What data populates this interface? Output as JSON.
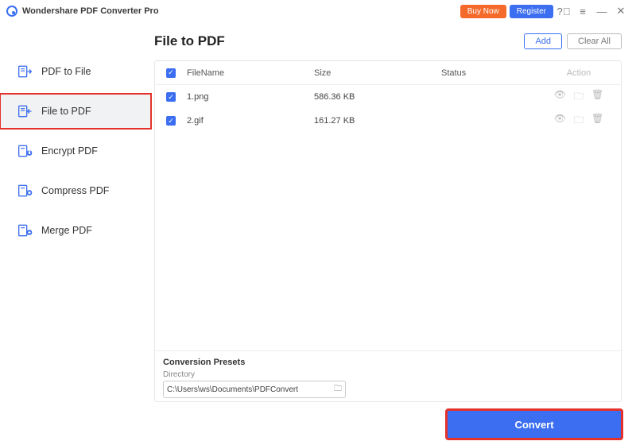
{
  "app": {
    "title": "Wondershare PDF Converter Pro"
  },
  "titlebar": {
    "buy_label": "Buy Now",
    "register_label": "Register"
  },
  "sidebar": {
    "items": [
      {
        "label": "PDF to File",
        "icon": "arrow-right",
        "active": false
      },
      {
        "label": "File to PDF",
        "icon": "arrow-left",
        "active": true
      },
      {
        "label": "Encrypt PDF",
        "icon": "lock",
        "active": false
      },
      {
        "label": "Compress PDF",
        "icon": "compress",
        "active": false
      },
      {
        "label": "Merge PDF",
        "icon": "plus",
        "active": false
      }
    ]
  },
  "page": {
    "title": "File to PDF",
    "add_label": "Add",
    "clear_label": "Clear All"
  },
  "table": {
    "headers": {
      "name": "FileName",
      "size": "Size",
      "status": "Status",
      "action": "Action"
    },
    "rows": [
      {
        "checked": true,
        "name": "1.png",
        "size": "586.36 KB"
      },
      {
        "checked": true,
        "name": "2.gif",
        "size": "161.27 KB"
      }
    ]
  },
  "presets": {
    "title": "Conversion Presets",
    "dir_label": "Directory",
    "dir_value": "C:\\Users\\ws\\Documents\\PDFConvert"
  },
  "footer": {
    "convert_label": "Convert"
  }
}
